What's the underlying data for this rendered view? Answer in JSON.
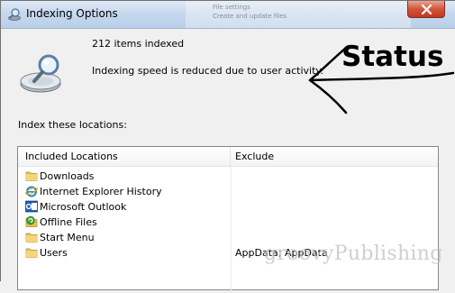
{
  "window": {
    "title": "Indexing Options",
    "background_hint_line1": "File settings",
    "background_hint_line2": "Create and update files"
  },
  "status": {
    "items_indexed": "212 items indexed",
    "message": "Indexing speed is reduced due to user activity."
  },
  "annotation": {
    "label": "Status"
  },
  "locations": {
    "section_label": "Index these locations:",
    "columns": {
      "included": "Included Locations",
      "exclude": "Exclude"
    },
    "rows": [
      {
        "name": "Downloads",
        "exclude": "",
        "icon": "folder-icon"
      },
      {
        "name": "Internet Explorer History",
        "exclude": "",
        "icon": "internet-explorer-icon"
      },
      {
        "name": "Microsoft Outlook",
        "exclude": "",
        "icon": "outlook-icon"
      },
      {
        "name": "Offline Files",
        "exclude": "",
        "icon": "offline-files-icon"
      },
      {
        "name": "Start Menu",
        "exclude": "",
        "icon": "folder-icon"
      },
      {
        "name": "Users",
        "exclude": "AppData; AppData",
        "icon": "folder-icon"
      }
    ]
  },
  "watermark": {
    "text": "groovyPublishing"
  },
  "colors": {
    "titlebar": "#c6d8ee",
    "close_button": "#d2553a",
    "window_bg": "#f0f0f0",
    "list_bg": "#ffffff"
  }
}
